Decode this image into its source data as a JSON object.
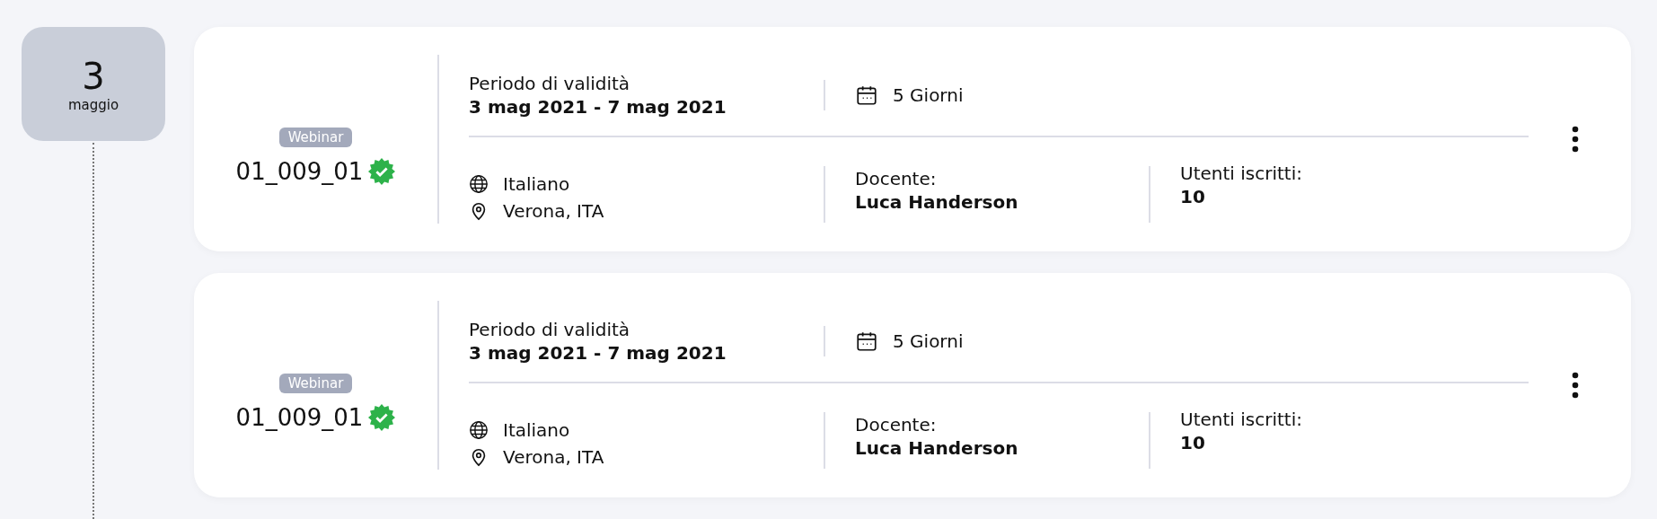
{
  "date": {
    "day": "3",
    "month": "maggio"
  },
  "courses": [
    {
      "type": "Webinar",
      "code": "01_009_01",
      "verified": true,
      "period_label": "Periodo di validità",
      "period": "3 mag 2021 - 7 mag 2021",
      "duration": "5 Giorni",
      "language": "Italiano",
      "location": "Verona, ITA",
      "teacher_label": "Docente:",
      "teacher": "Luca Handerson",
      "users_label": "Utenti iscritti:",
      "users": "10"
    },
    {
      "type": "Webinar",
      "code": "01_009_01",
      "verified": true,
      "period_label": "Periodo di validità",
      "period": "3 mag 2021 - 7 mag 2021",
      "duration": "5 Giorni",
      "language": "Italiano",
      "location": "Verona, ITA",
      "teacher_label": "Docente:",
      "teacher": "Luca Handerson",
      "users_label": "Utenti iscritti:",
      "users": "10"
    }
  ]
}
